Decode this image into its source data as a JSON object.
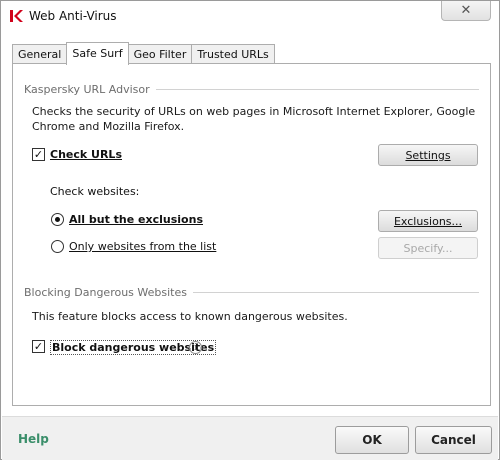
{
  "window": {
    "title": "Web Anti-Virus",
    "close_glyph": "✕",
    "logo_icon": "kaspersky-k-icon",
    "logo_color": "#d0021b"
  },
  "tabs": [
    {
      "label": "General",
      "active": false
    },
    {
      "label": "Safe Surf",
      "active": true
    },
    {
      "label": "Geo Filter",
      "active": false
    },
    {
      "label": "Trusted URLs",
      "active": false
    }
  ],
  "url_advisor": {
    "header": "Kaspersky URL Advisor",
    "description_line1": "Checks the security of URLs on web pages in Microsoft Internet Explorer, Google",
    "description_line2": "Chrome and Mozilla Firefox.",
    "check_urls_label": "Check URLs",
    "check_urls_checked": true,
    "settings_button": "Settings",
    "check_websites_label": "Check websites:",
    "option_all_label": "All but the exclusions",
    "option_all_selected": true,
    "option_list_label": "Only websites from the list",
    "option_list_selected": false,
    "exclusions_button": "Exclusions...",
    "specify_button": "Specify..."
  },
  "blocking": {
    "header": "Blocking Dangerous Websites",
    "description": "This feature blocks access to known dangerous websites.",
    "block_label": "Block dangerous websites",
    "block_checked": true,
    "info_glyph": "i"
  },
  "footer": {
    "help_label": "Help",
    "help_color": "#3a8e6a",
    "ok_button": "OK",
    "cancel_button": "Cancel"
  }
}
